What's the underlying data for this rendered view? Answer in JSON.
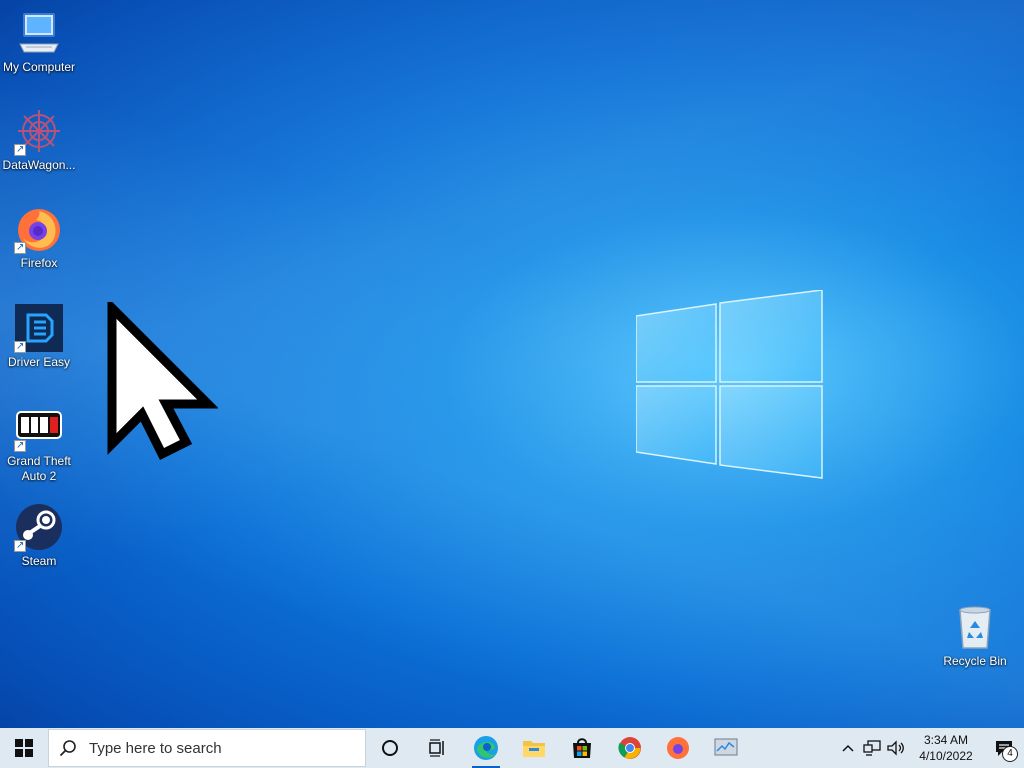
{
  "desktop": {
    "icons": [
      {
        "label": "My Computer",
        "icon": "my-computer-icon"
      },
      {
        "label": "DataWagon...",
        "icon": "datawagon-icon"
      },
      {
        "label": "Firefox",
        "icon": "firefox-icon"
      },
      {
        "label": "Driver Easy",
        "icon": "driver-easy-icon"
      },
      {
        "label": "Grand Theft Auto 2",
        "icon": "gta2-icon"
      },
      {
        "label": "Steam",
        "icon": "steam-icon"
      }
    ],
    "recycle_bin": {
      "label": "Recycle Bin",
      "icon": "recycle-bin-icon"
    }
  },
  "taskbar": {
    "search_placeholder": "Type here to search",
    "pinned": [
      "cortana-icon",
      "task-view-icon",
      "edge-icon",
      "file-explorer-icon",
      "store-icon",
      "chrome-icon",
      "firefox-icon",
      "task-manager-icon"
    ],
    "clock": {
      "time": "3:34 AM",
      "date": "4/10/2022"
    },
    "notification_count": "4"
  },
  "colors": {
    "accent": "#0a63c9",
    "taskbar_bg": "#dfe9f2",
    "wallpaper": "#0b6fd6"
  }
}
